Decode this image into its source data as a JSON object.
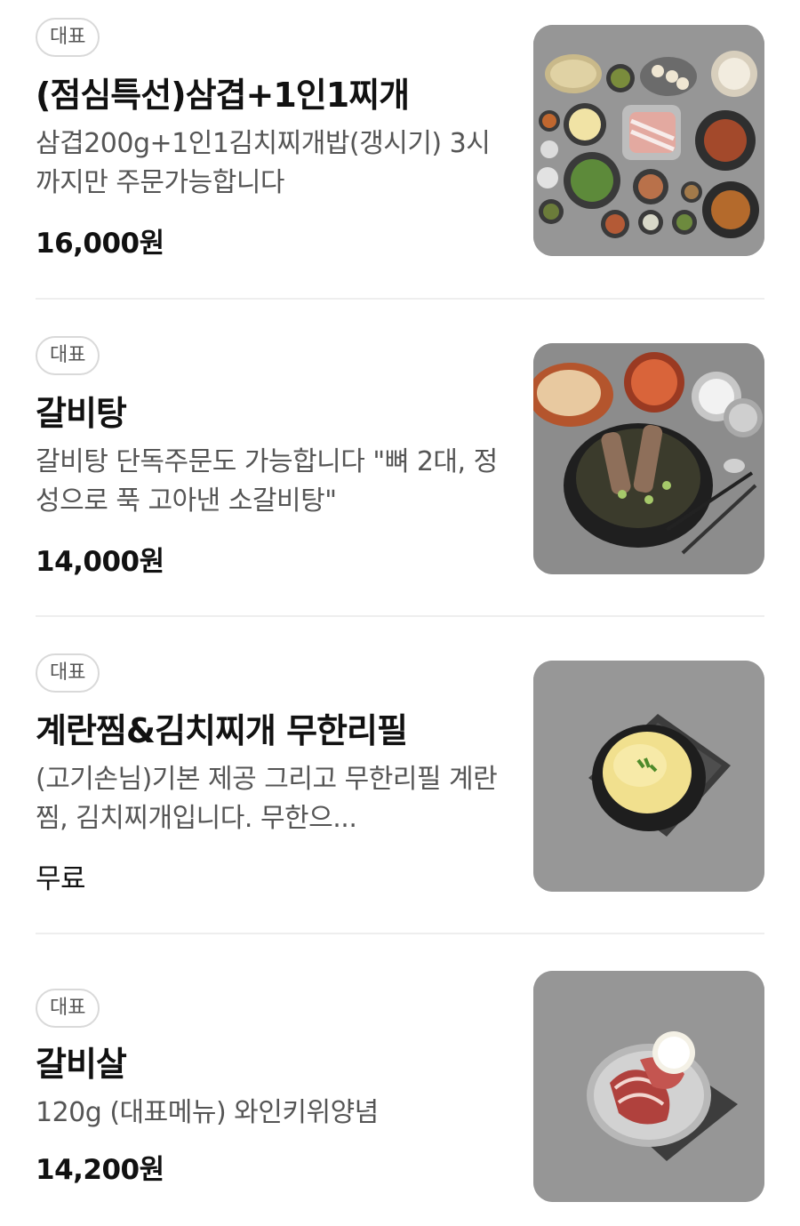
{
  "menu_items": [
    {
      "badge": "대표",
      "title": "(점심특선)삼겹+1인1찌개",
      "description": "삼겹200g+1인1김치찌개밥(갱시기) 3시까지만 주문가능합니다",
      "price": "16,000원",
      "image_icon": "banchan-spread-photo"
    },
    {
      "badge": "대표",
      "title": "갈비탕",
      "description": "갈비탕 단독주문도 가능합니다 \"뼈 2대, 정성으로 푹 고아낸 소갈비탕\"",
      "price": "14,000원",
      "image_icon": "galbitang-photo"
    },
    {
      "badge": "대표",
      "title": "계란찜&김치찌개 무한리필",
      "description": "(고기손님)기본 제공 그리고 무한리필 계란찜, 김치찌개입니다. 무한으...",
      "price": "무료",
      "image_icon": "egg-custard-photo"
    },
    {
      "badge": "대표",
      "title": "갈비살",
      "description": "120g (대표메뉴) 와인키위양념",
      "price": "14,200원",
      "image_icon": "galbisal-photo"
    }
  ]
}
